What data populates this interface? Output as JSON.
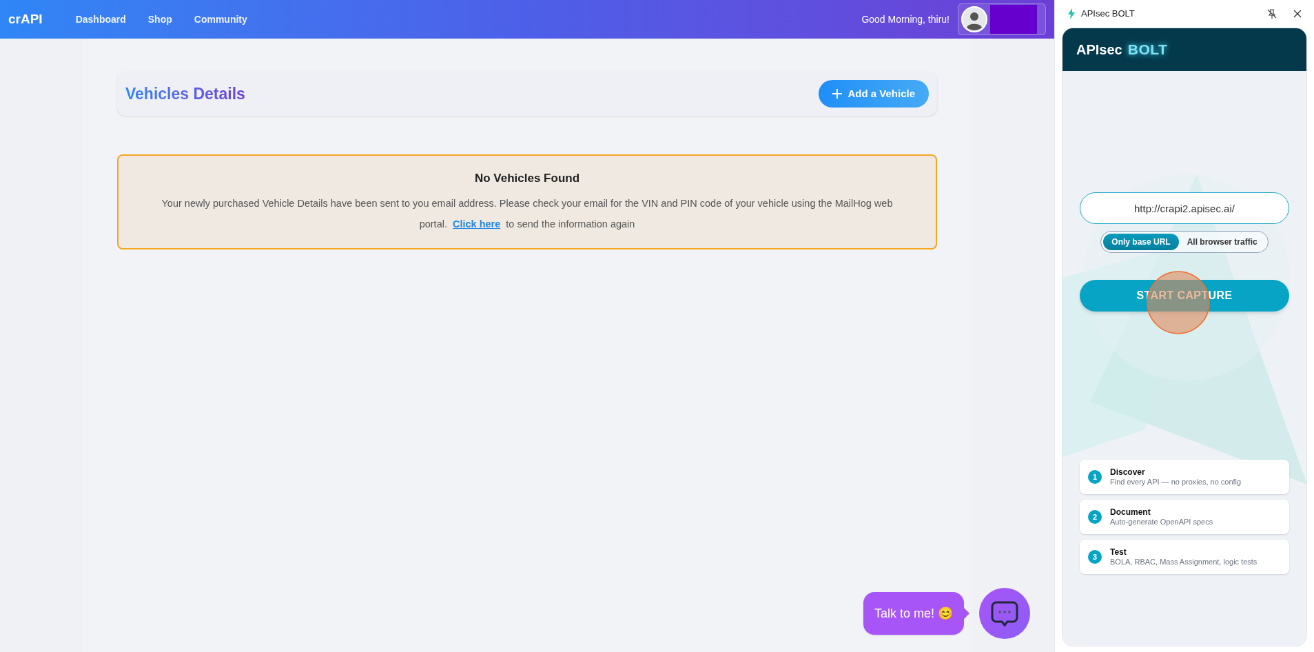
{
  "navbar": {
    "brand": "crAPI",
    "links": [
      "Dashboard",
      "Shop",
      "Community"
    ],
    "greeting": "Good Morning, thiru!"
  },
  "page": {
    "title": "Vehicles Details",
    "add_button": "Add a Vehicle"
  },
  "alert": {
    "title": "No Vehicles Found",
    "message": "Your newly purchased Vehicle Details have been sent to you email address. Please check your email for the VIN and PIN code of your vehicle using the MailHog web portal.",
    "link": "Click here",
    "message_after": "to send the information again"
  },
  "chat": {
    "bubble": "Talk to me! 😊"
  },
  "side_panel": {
    "window_title": "APIsec BOLT",
    "header": {
      "brand": "APIsec",
      "product": "BOLT"
    },
    "url_field": {
      "value": "http://crapi2.apisec.ai/"
    },
    "scope_options": [
      {
        "label": "Only base URL",
        "selected": true
      },
      {
        "label": "All browser traffic",
        "selected": false
      }
    ],
    "start_button": "START CAPTURE",
    "steps": [
      {
        "number": "1",
        "title": "Discover",
        "description": "Find every API — no proxies, no config"
      },
      {
        "number": "2",
        "title": "Document",
        "description": "Auto-generate OpenAPI specs"
      },
      {
        "number": "3",
        "title": "Test",
        "description": "BOLA, RBAC, Mass Assignment, logic tests"
      }
    ]
  }
}
